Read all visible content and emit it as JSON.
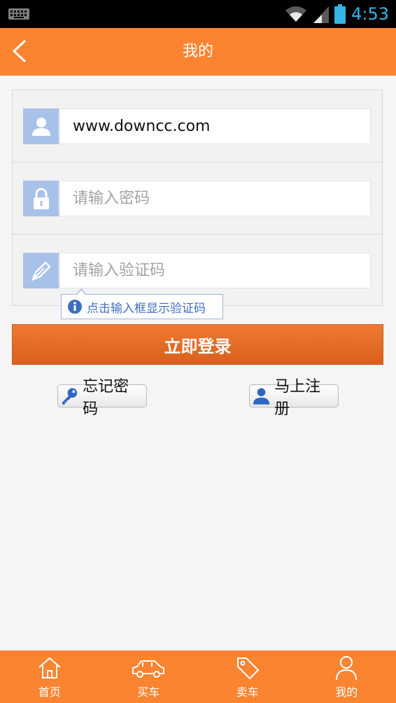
{
  "status_bar": {
    "time": "4:53",
    "icons": [
      "keyboard-icon",
      "wifi-icon",
      "signal-icon",
      "battery-icon"
    ]
  },
  "header": {
    "title": "我的",
    "back_icon": "chevron-left-icon"
  },
  "form": {
    "username": {
      "value": "www.downcc.com",
      "icon": "user-icon"
    },
    "password": {
      "placeholder": "请输入密码",
      "icon": "lock-icon"
    },
    "captcha": {
      "placeholder": "请输入验证码",
      "icon": "pencil-icon"
    }
  },
  "hint": {
    "text": "点击输入框显示验证码",
    "icon": "info-icon"
  },
  "login_button": {
    "label": "立即登录"
  },
  "forgot_button": {
    "label": "忘记密码",
    "icon": "key-icon"
  },
  "register_button": {
    "label": "马上注册",
    "icon": "user-icon"
  },
  "bottom_nav": {
    "items": [
      {
        "label": "首页",
        "icon": "home-icon"
      },
      {
        "label": "买车",
        "icon": "car-icon"
      },
      {
        "label": "卖车",
        "icon": "tag-icon"
      },
      {
        "label": "我的",
        "icon": "person-icon"
      }
    ]
  },
  "colors": {
    "accent": "#fb8430",
    "login": "#e06a24",
    "field_icon_bg": "#a8c1e8",
    "status_time": "#35b5e5"
  }
}
